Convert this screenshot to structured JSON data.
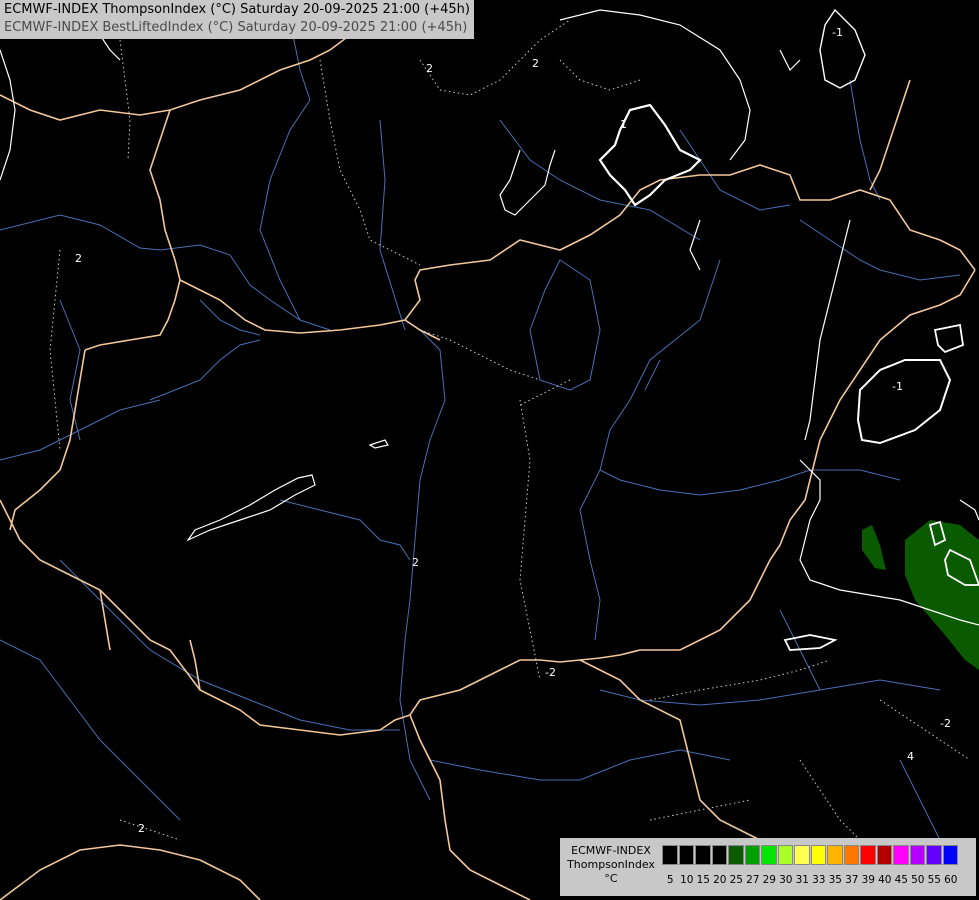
{
  "header": {
    "line1": "ECMWF-INDEX ThompsonIndex (°C) Saturday 20-09-2025 21:00 (+45h)",
    "line2": "ECMWF-INDEX BestLiftedIndex (°C) Saturday 20-09-2025 21:00 (+45h)"
  },
  "map": {
    "contour_labels": [
      "2",
      "2",
      "1",
      "-1",
      "2",
      "-1",
      "2",
      "2",
      "-2",
      "4",
      "-2"
    ]
  },
  "legend": {
    "title": "ECMWF-INDEX",
    "subtitle": "ThompsonIndex",
    "unit": "°C",
    "ticks": [
      "5",
      "10",
      "15",
      "20",
      "25",
      "27",
      "29",
      "30",
      "31",
      "33",
      "35",
      "37",
      "39",
      "40",
      "45",
      "50",
      "55",
      "60"
    ],
    "colors": [
      "#000000",
      "#000000",
      "#000000",
      "#000000",
      "#0a5a00",
      "#00a000",
      "#00e600",
      "#aaff28",
      "#ffff50",
      "#ffff00",
      "#ffb400",
      "#ff7800",
      "#ff0000",
      "#b40000",
      "#ff00ff",
      "#b400ff",
      "#6400ff",
      "#0000ff"
    ]
  },
  "colors": {
    "background": "#000000",
    "borders": "#f2c79a",
    "rivers": "#4a6fb5",
    "contours": "#ffffff",
    "highlight_fill": "#0a5a00"
  }
}
